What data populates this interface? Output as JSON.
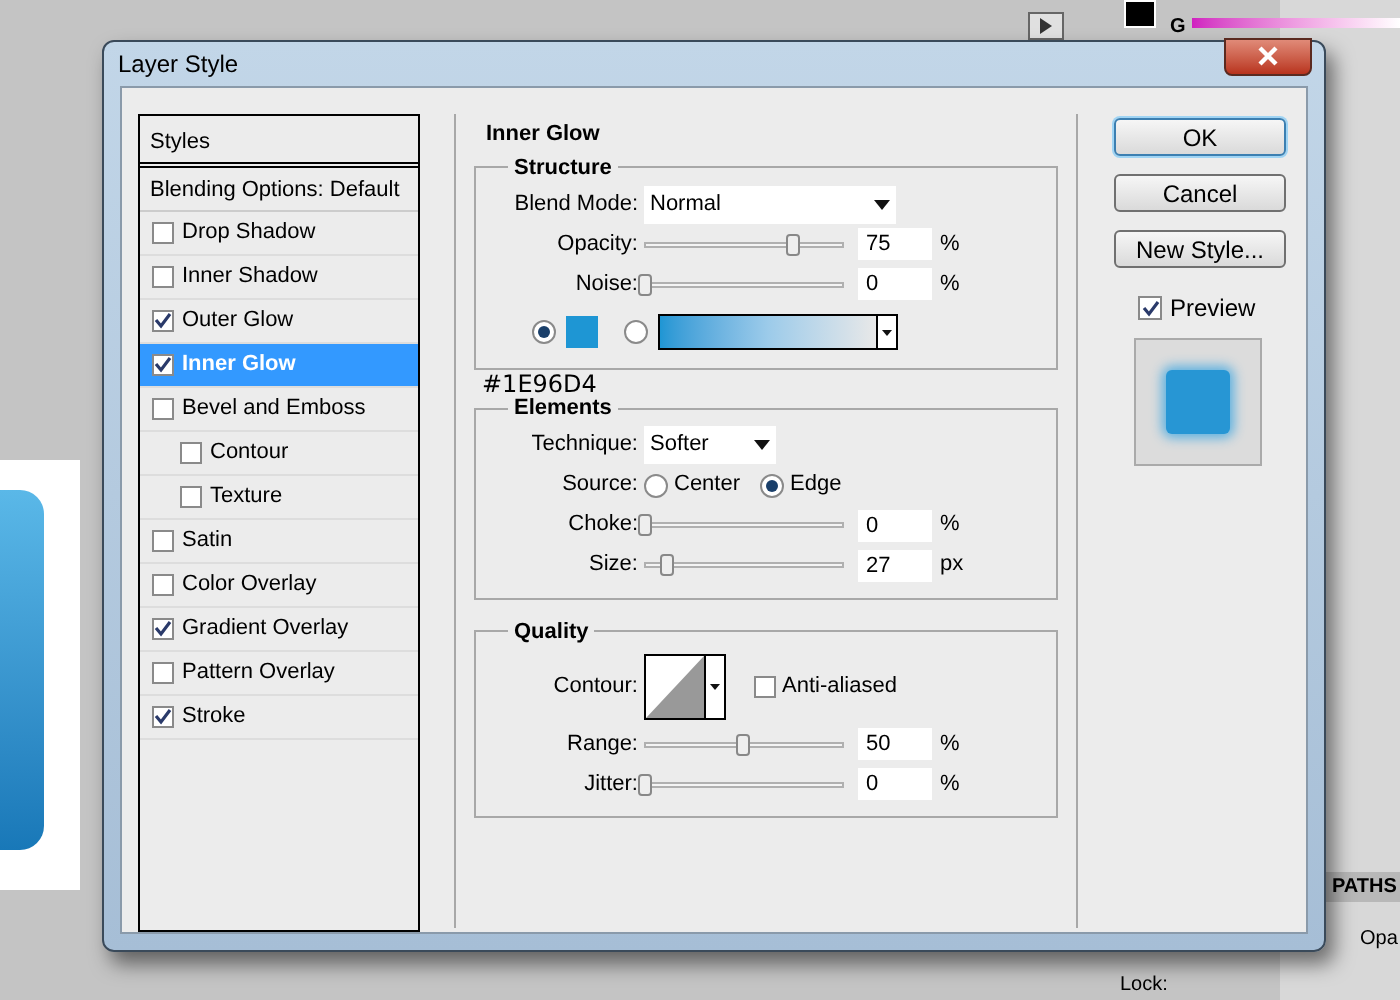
{
  "window": {
    "title": "Layer Style"
  },
  "styles_list": {
    "header": "Styles",
    "blending_options": {
      "label": "Blending Options: Default",
      "selected": false
    },
    "effects": [
      {
        "label": "Drop Shadow",
        "checked": false,
        "selected": false
      },
      {
        "label": "Inner Shadow",
        "checked": false,
        "selected": false
      },
      {
        "label": "Outer Glow",
        "checked": true,
        "selected": false
      },
      {
        "label": "Inner Glow",
        "checked": true,
        "selected": true
      },
      {
        "label": "Bevel and Emboss",
        "checked": false,
        "selected": false,
        "children": [
          {
            "label": "Contour",
            "checked": false,
            "selected": false
          },
          {
            "label": "Texture",
            "checked": false,
            "selected": false
          }
        ]
      },
      {
        "label": "Satin",
        "checked": false,
        "selected": false
      },
      {
        "label": "Color Overlay",
        "checked": false,
        "selected": false
      },
      {
        "label": "Gradient Overlay",
        "checked": true,
        "selected": false
      },
      {
        "label": "Pattern Overlay",
        "checked": false,
        "selected": false
      },
      {
        "label": "Stroke",
        "checked": true,
        "selected": false
      }
    ]
  },
  "panel": {
    "title": "Inner Glow",
    "structure": {
      "title": "Structure",
      "blend_mode": {
        "label": "Blend Mode:",
        "value": "Normal"
      },
      "sliders": [
        {
          "label": "Opacity:",
          "level": 0.75,
          "value": "75",
          "unit": "%"
        },
        {
          "label": "Noise:",
          "level": 0,
          "value": "0",
          "unit": "%"
        }
      ],
      "fill_options": [
        {
          "kind": "color",
          "selected": true,
          "color": "#1e96d4"
        },
        {
          "kind": "gradient",
          "selected": false
        }
      ],
      "color_note": "#1E96D4"
    },
    "elements": {
      "title": "Elements",
      "technique": {
        "label": "Technique:",
        "value": "Softer"
      },
      "source": {
        "label": "Source:",
        "options": [
          {
            "label": "Center",
            "selected": false
          },
          {
            "label": "Edge",
            "selected": true
          }
        ]
      },
      "sliders": [
        {
          "label": "Choke:",
          "level": 0,
          "value": "0",
          "unit": "%"
        },
        {
          "label": "Size:",
          "level": 0.11,
          "value": "27",
          "unit": "px"
        }
      ]
    },
    "quality": {
      "title": "Quality",
      "contour_label": "Contour:",
      "anti_aliased": {
        "label": "Anti-aliased",
        "checked": false
      },
      "sliders": [
        {
          "label": "Range:",
          "level": 0.5,
          "value": "50",
          "unit": "%"
        },
        {
          "label": "Jitter:",
          "level": 0,
          "value": "0",
          "unit": "%"
        }
      ]
    }
  },
  "buttons": [
    {
      "label": "OK",
      "default": true
    },
    {
      "label": "Cancel",
      "default": false
    },
    {
      "label": "New Style...",
      "default": false
    }
  ],
  "preview": {
    "label": "Preview",
    "checked": true
  },
  "background": {
    "channel_label": "G",
    "panel_tab": "PATHS",
    "opacity_label": "Opa",
    "lock_label": "Lock:"
  }
}
